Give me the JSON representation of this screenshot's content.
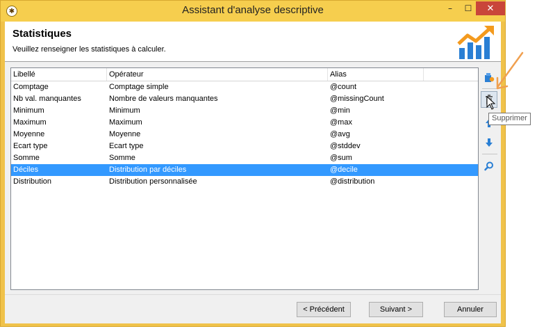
{
  "window": {
    "title": "Assistant d'analyse descriptive",
    "min_glyph": "–",
    "max_glyph": "☐",
    "close_glyph": "✕"
  },
  "header": {
    "title": "Statistiques",
    "subtitle": "Veuillez renseigner les statistiques à calculer."
  },
  "table": {
    "columns": [
      "Libellé",
      "Opérateur",
      "Alias",
      ""
    ],
    "rows": [
      {
        "label": "Comptage",
        "operator": "Comptage simple",
        "alias": "@count"
      },
      {
        "label": "Nb val. manquantes",
        "operator": "Nombre de valeurs manquantes",
        "alias": "@missingCount"
      },
      {
        "label": "Minimum",
        "operator": "Minimum",
        "alias": "@min"
      },
      {
        "label": "Maximum",
        "operator": "Maximum",
        "alias": "@max"
      },
      {
        "label": "Moyenne",
        "operator": "Moyenne",
        "alias": "@avg"
      },
      {
        "label": "Ecart type",
        "operator": "Ecart type",
        "alias": "@stddev"
      },
      {
        "label": "Somme",
        "operator": "Somme",
        "alias": "@sum"
      },
      {
        "label": "Déciles",
        "operator": "Distribution par déciles",
        "alias": "@decile"
      },
      {
        "label": "Distribution",
        "operator": "Distribution personnalisée",
        "alias": "@distribution"
      }
    ],
    "selected_label": "Déciles"
  },
  "tooltip": {
    "text": "Supprimer"
  },
  "buttons": {
    "previous": "< Précédent",
    "next": "Suivant >",
    "cancel": "Annuler"
  },
  "colors": {
    "titlebar": "#f6ce4e",
    "selection": "#3399ff",
    "close": "#c9453a",
    "annotation_arrow": "#f0a050"
  }
}
